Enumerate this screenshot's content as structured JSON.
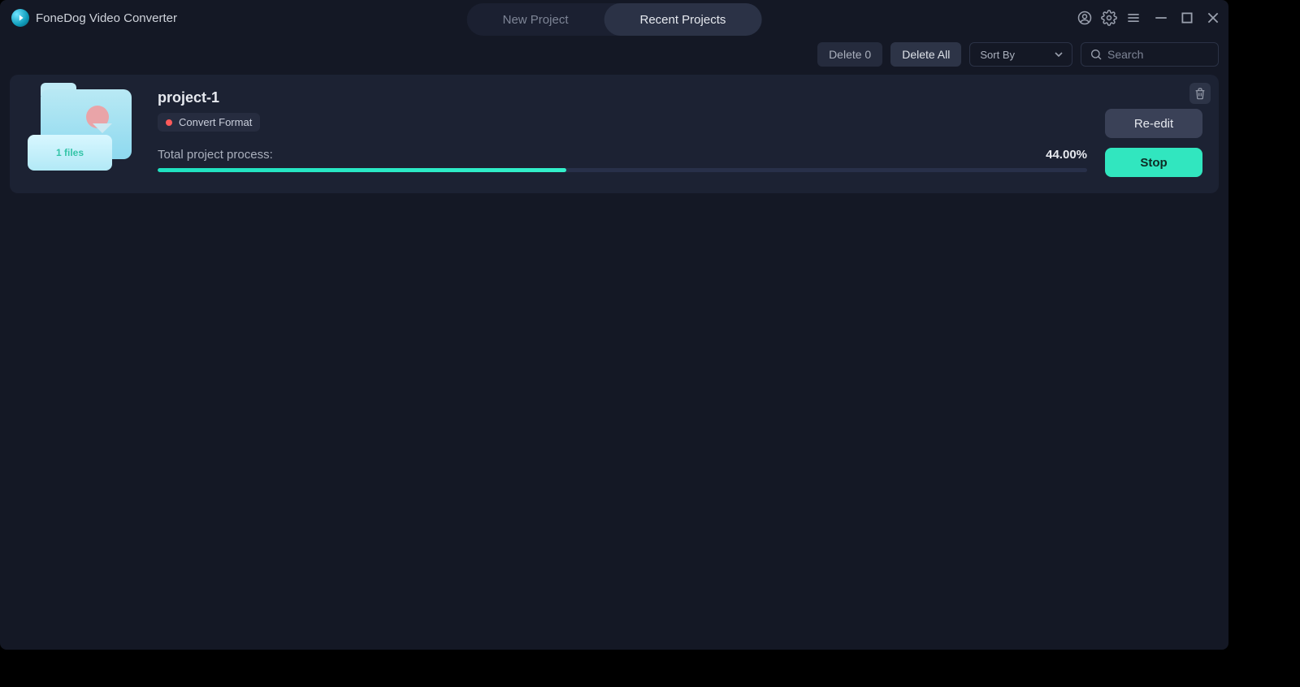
{
  "app": {
    "title": "FoneDog Video Converter"
  },
  "tabs": {
    "new_project": "New Project",
    "recent_projects": "Recent Projects",
    "active": "recent_projects"
  },
  "toolbar": {
    "delete_count_label": "Delete 0",
    "delete_all_label": "Delete All",
    "sort_by_label": "Sort By",
    "search_placeholder": "Search"
  },
  "project": {
    "name": "project-1",
    "status_label": "Convert Format",
    "files_label": "1 files",
    "process_label": "Total project process:",
    "progress_percent": 44.0,
    "progress_percent_label": "44.00%",
    "reedit_label": "Re-edit",
    "stop_label": "Stop"
  }
}
